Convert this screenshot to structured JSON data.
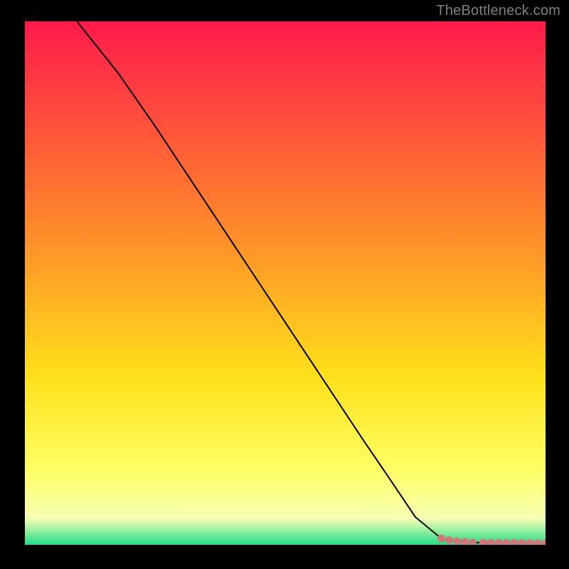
{
  "attribution": "TheBottleneck.com",
  "colors": {
    "background": "#000000",
    "attribution_text": "#7f7f7f",
    "curve": "#000000",
    "point_fill": "#cf7a78",
    "point_stroke": "#cf7a78",
    "gradient_top": "#ff1a4b",
    "gradient_mid1": "#ff8a2a",
    "gradient_mid2": "#ffe11a",
    "gradient_mid3": "#ffff66",
    "gradient_low": "#f6ffb3",
    "gradient_bottom": "#22dd88"
  },
  "chart_data": {
    "type": "line",
    "title": "",
    "xlabel": "",
    "ylabel": "",
    "xlim": [
      0,
      100
    ],
    "ylim": [
      0,
      100
    ],
    "grid": false,
    "series": [
      {
        "name": "bottleneck-curve",
        "x": [
          10,
          18,
          25,
          30,
          35,
          40,
          45,
          50,
          55,
          60,
          65,
          70,
          75,
          80,
          83,
          86,
          88,
          90,
          92,
          94,
          96,
          98,
          100
        ],
        "y": [
          100,
          90,
          80,
          72.5,
          65,
          57.5,
          50,
          42.5,
          35,
          27.5,
          20,
          12.7,
          5.3,
          1.2,
          0.6,
          0.45,
          0.4,
          0.38,
          0.36,
          0.35,
          0.34,
          0.33,
          0.33
        ]
      }
    ],
    "points": {
      "name": "highlighted-range",
      "x": [
        80,
        81.5,
        83,
        84.5,
        86,
        88,
        89.5,
        91,
        92.5,
        94,
        95.5,
        97,
        98.5,
        100
      ],
      "y": [
        1.2,
        0.9,
        0.7,
        0.55,
        0.45,
        0.42,
        0.4,
        0.39,
        0.38,
        0.37,
        0.36,
        0.35,
        0.34,
        0.34
      ]
    }
  }
}
